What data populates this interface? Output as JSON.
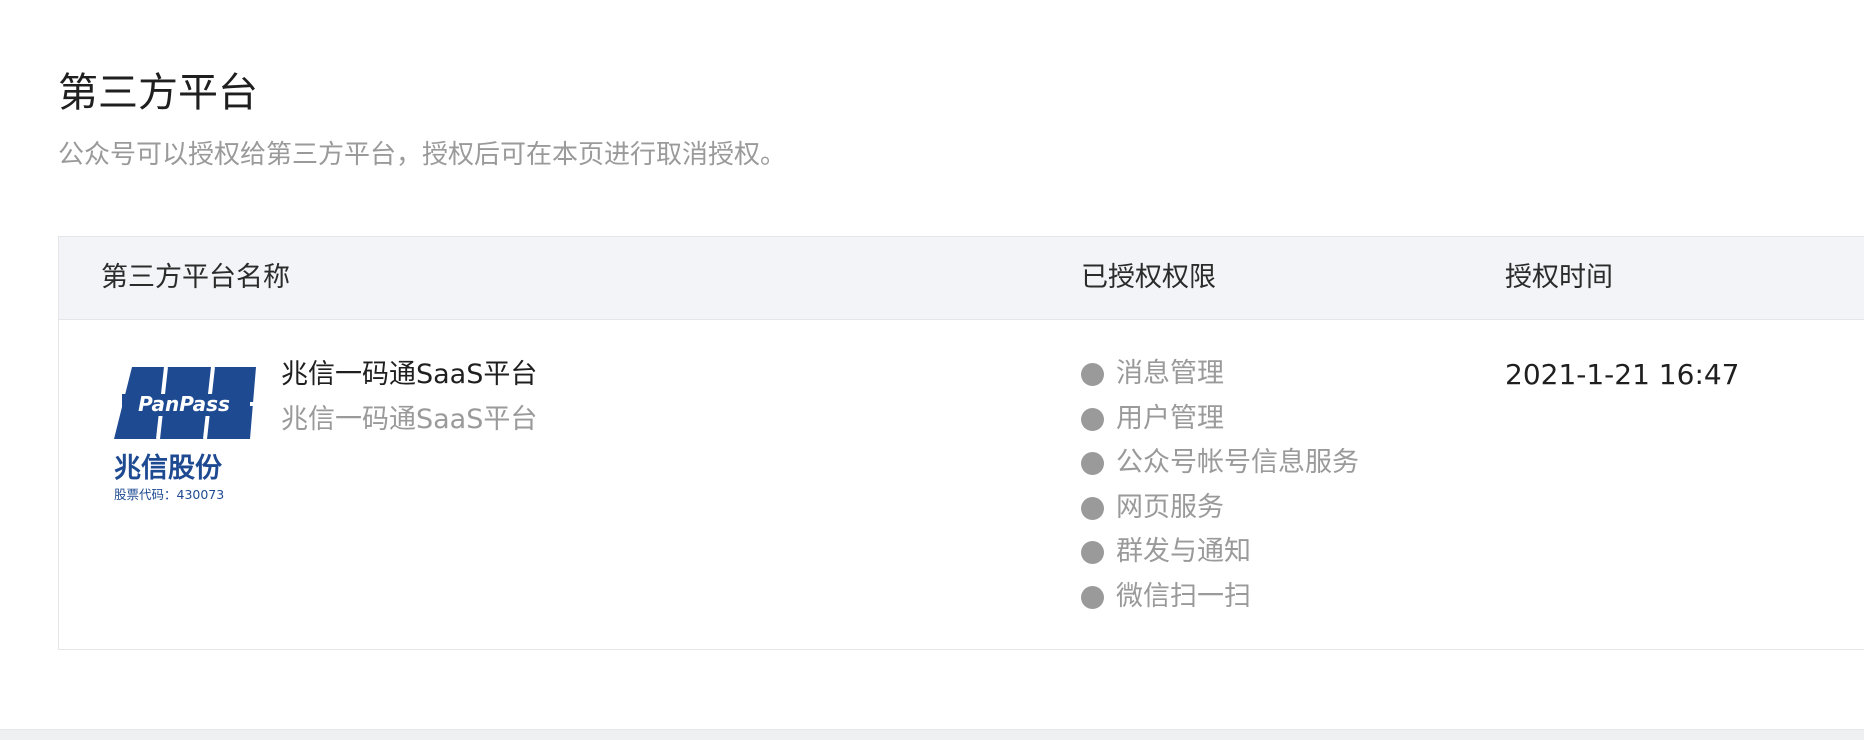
{
  "header": {
    "title": "第三方平台",
    "description": "公众号可以授权给第三方平台，授权后可在本页进行取消授权。"
  },
  "table": {
    "columns": [
      "第三方平台名称",
      "已授权权限",
      "授权时间"
    ],
    "rows": [
      {
        "logo": {
          "name": "panpass-logo-icon",
          "brand_text": "PanPass",
          "company_text": "兆信股份",
          "stock_text": "股票代码：430073",
          "brand_color": "#1e4a92"
        },
        "name": "兆信一码通SaaS平台",
        "subname": "兆信一码通SaaS平台",
        "permissions": [
          "消息管理",
          "用户管理",
          "公众号帐号信息服务",
          "网页服务",
          "群发与通知",
          "微信扫一扫"
        ],
        "auth_time": "2021-1-21 16:47"
      }
    ]
  }
}
